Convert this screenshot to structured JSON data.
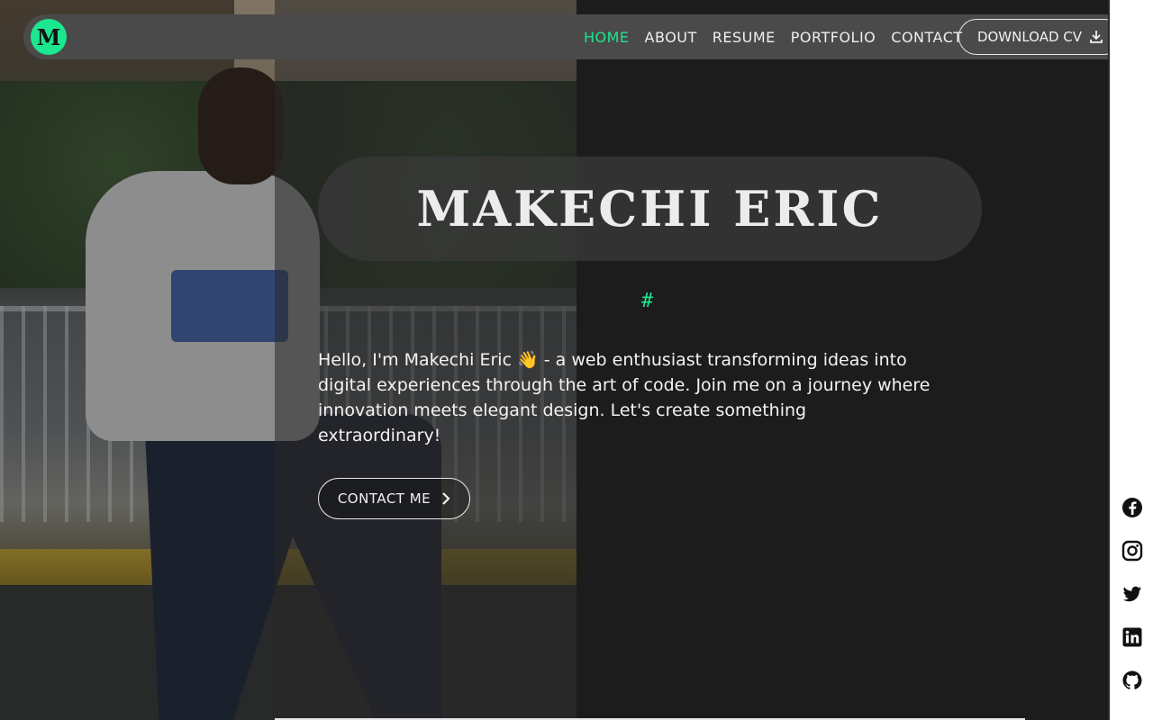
{
  "nav": {
    "logo_letter": "M",
    "links": [
      "HOME",
      "ABOUT",
      "RESUME",
      "PORTFOLIO",
      "CONTACT"
    ],
    "active": "HOME",
    "download_cv_label": "DOWNLOAD CV"
  },
  "hero": {
    "name": "MAKECHI ERIC",
    "hash": "#",
    "intro": "Hello, I'm Makechi Eric 👋 - a web enthusiast transforming ideas into digital experiences through the art of code. Join me on a journey where innovation meets elegant design. Let's create something extraordinary!",
    "contact_label": "CONTACT ME"
  },
  "social": [
    "facebook-icon",
    "instagram-icon",
    "twitter-icon",
    "linkedin-icon",
    "github-icon"
  ],
  "colors": {
    "accent": "#1ce68f",
    "background": "#1c1c1c",
    "navbar": "#4a4a4a"
  }
}
